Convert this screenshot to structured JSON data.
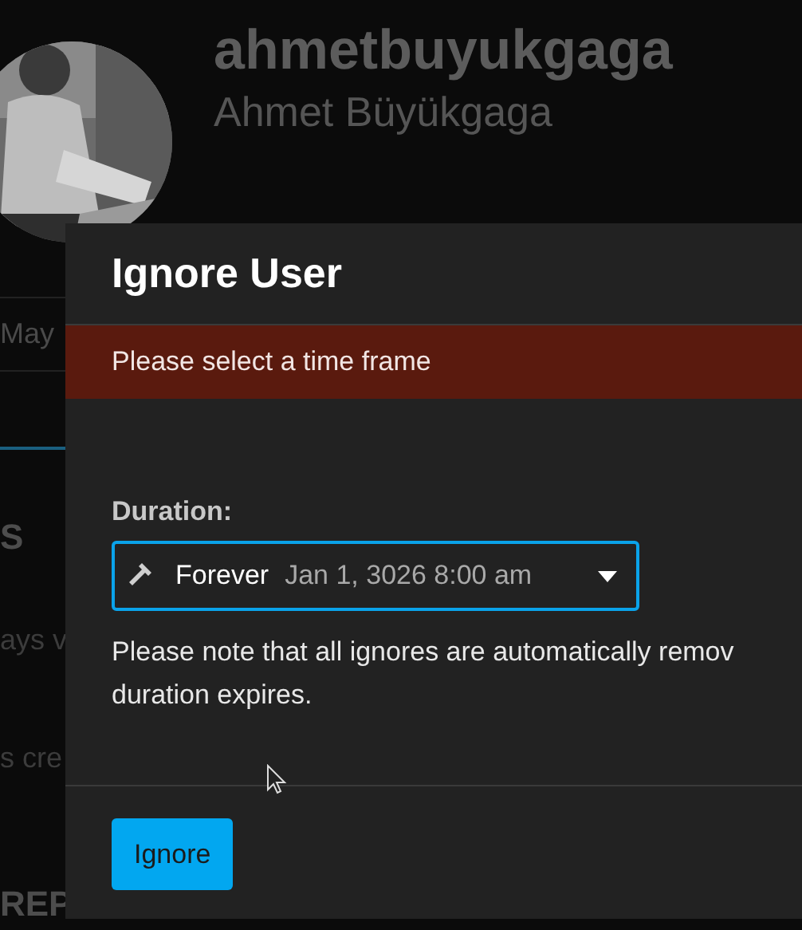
{
  "profile": {
    "username": "ahmetbuyukgaga",
    "full_name": "Ahmet Büyükgaga"
  },
  "background_texts": [
    {
      "kind": "meta",
      "text": "May"
    },
    {
      "kind": "heading",
      "text": "S"
    },
    {
      "kind": "body",
      "text": "ays v"
    },
    {
      "kind": "body",
      "text": "s cre"
    },
    {
      "kind": "heading",
      "text": "REP"
    }
  ],
  "dialog": {
    "title": "Ignore User",
    "error": "Please select a time frame",
    "duration": {
      "label": "Duration:",
      "value": "Forever",
      "date": "Jan 1, 3026 8:00 am"
    },
    "note_lines": [
      "Please note that all ignores are automatically remov",
      "duration expires."
    ],
    "buttons": [
      "Ignore"
    ]
  }
}
